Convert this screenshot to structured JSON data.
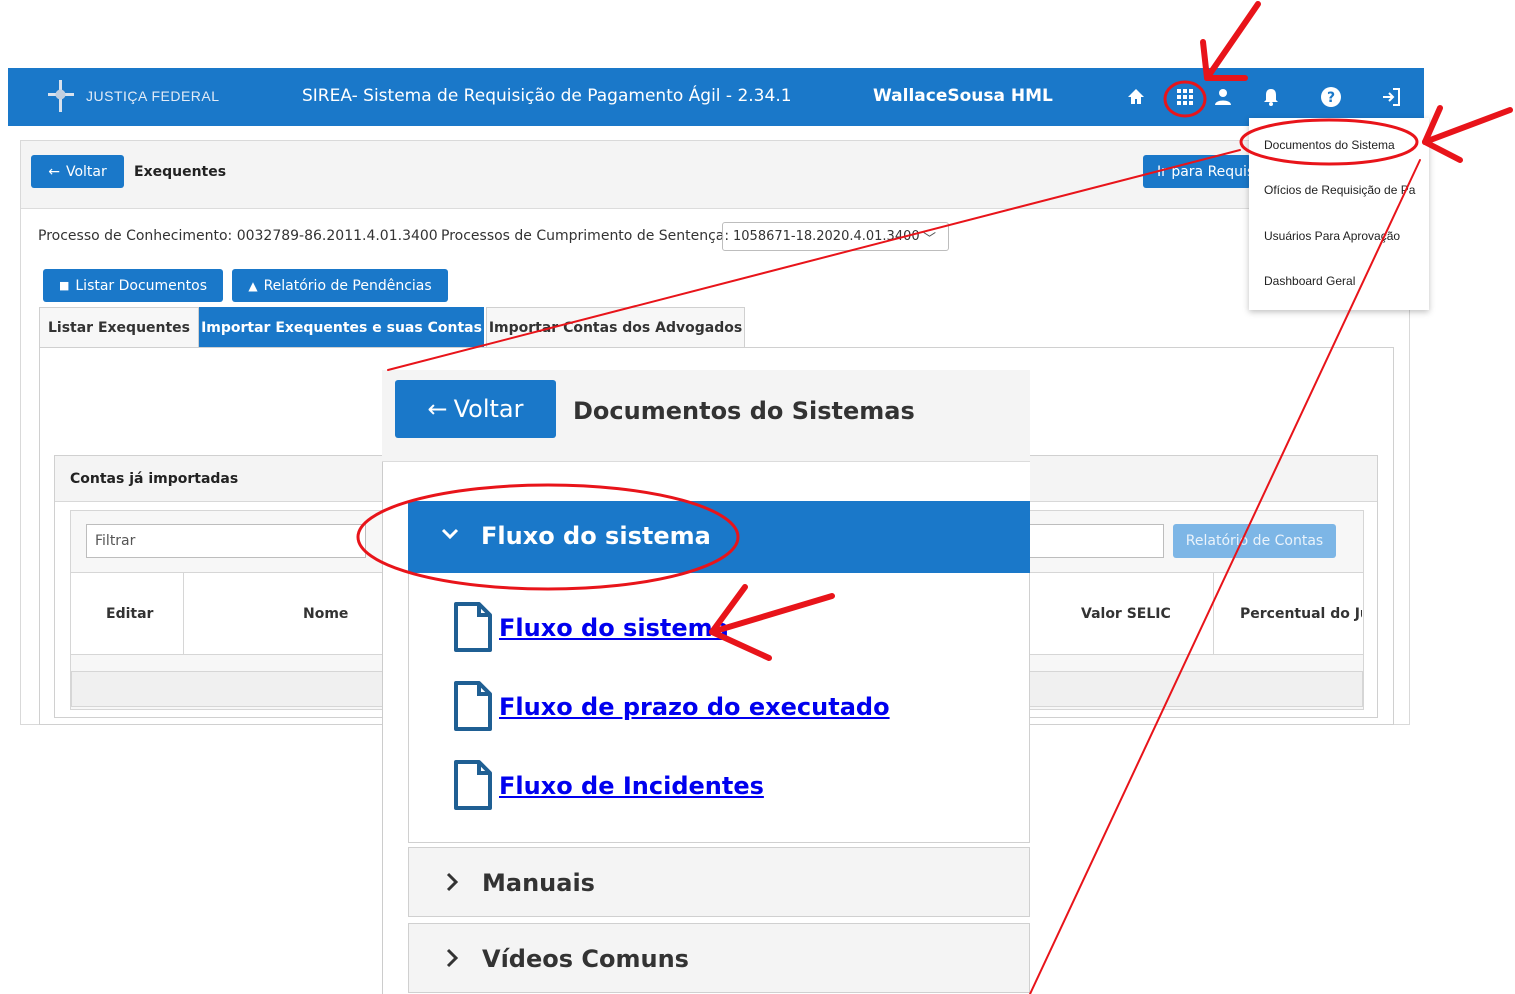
{
  "topbar": {
    "logo_text": "JUSTIÇA FEDERAL",
    "app_title": "SIREA- Sistema de Requisição de Pagamento Ágil - 2.34.1",
    "user_name": "WallaceSousa HML",
    "icons": [
      "home-icon",
      "apps-grid-icon",
      "person-icon",
      "bell-icon",
      "help-icon",
      "logout-icon"
    ]
  },
  "header": {
    "back_label": "Voltar",
    "title": "Exequentes",
    "go_label": "Ir para Requis"
  },
  "process": {
    "conhecimento_label": "Processo de Conhecimento: 0032789-86.2011.4.01.3400",
    "cumprimento_label": "Processos de Cumprimento de Sentença:",
    "cumprimento_value": "1058671-18.2020.4.01.3400"
  },
  "actions": {
    "list_docs": "Listar Documentos",
    "pendencias": "Relatório de Pendências"
  },
  "tabs": [
    {
      "label": "Listar Exequentes"
    },
    {
      "label": "Importar Exequentes e suas Contas"
    },
    {
      "label": "Importar Contas dos Advogados"
    }
  ],
  "accounts": {
    "title": "Contas já importadas",
    "filter_placeholder": "Filtrar",
    "report_label": "Relatório de Contas",
    "columns": [
      "Editar",
      "Nome",
      "Valor SELIC",
      "Percentual do Juro"
    ]
  },
  "menu": {
    "items": [
      "Documentos do Sistema",
      "Ofícios de Requisição de Pa",
      "Usuários Para Aprovação",
      "Dashboard Geral"
    ]
  },
  "zoom": {
    "back_label": "Voltar",
    "title": "Documentos do Sistemas",
    "sections": [
      {
        "title": "Fluxo do sistema",
        "expanded": true,
        "links": [
          "Fluxo do sistema",
          "Fluxo de prazo do executado",
          "Fluxo de Incidentes"
        ]
      },
      {
        "title": "Manuais",
        "expanded": false
      },
      {
        "title": "Vídeos Comuns",
        "expanded": false
      }
    ]
  },
  "colors": {
    "primary": "#1a78c9",
    "annotation": "#e8141a",
    "link": "#0000ee"
  }
}
